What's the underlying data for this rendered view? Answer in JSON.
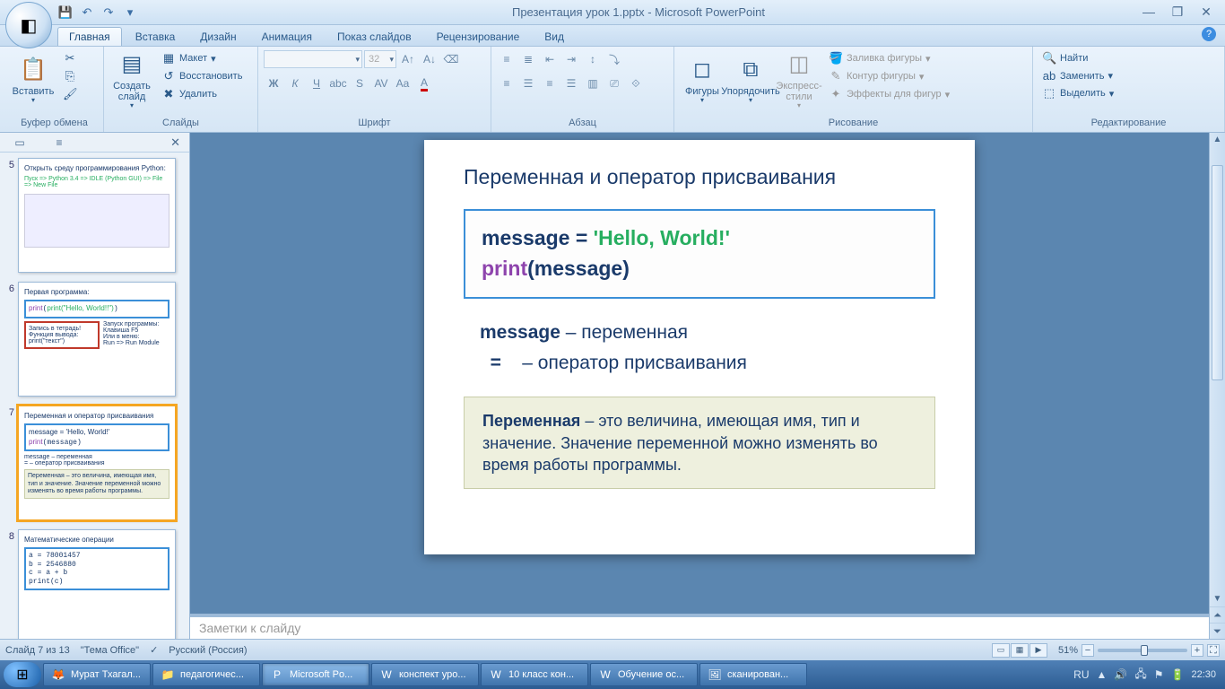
{
  "title": "Презентация урок 1.pptx - Microsoft PowerPoint",
  "tabs": {
    "home": "Главная",
    "insert": "Вставка",
    "design": "Дизайн",
    "animation": "Анимация",
    "slideshow": "Показ слайдов",
    "review": "Рецензирование",
    "view": "Вид"
  },
  "ribbon": {
    "clipboard": {
      "label": "Буфер обмена",
      "paste": "Вставить"
    },
    "slides": {
      "label": "Слайды",
      "new": "Создать\nслайд",
      "layout": "Макет",
      "reset": "Восстановить",
      "delete": "Удалить"
    },
    "font": {
      "label": "Шрифт",
      "size": "32"
    },
    "paragraph": {
      "label": "Абзац"
    },
    "drawing": {
      "label": "Рисование",
      "shapes": "Фигуры",
      "arrange": "Упорядочить",
      "styles": "Экспресс-стили",
      "fill": "Заливка фигуры",
      "outline": "Контур фигуры",
      "effects": "Эффекты для фигур"
    },
    "editing": {
      "label": "Редактирование",
      "find": "Найти",
      "replace": "Заменить",
      "select": "Выделить"
    }
  },
  "thumbs": {
    "n5": "5",
    "n6": "6",
    "n7": "7",
    "n8": "8",
    "t5_title": "Открыть среду программирования Python:",
    "t5_line": "Пуск => Python 3.4 => IDLE (Python GUI) => File => New File",
    "t6_title": "Первая программа:",
    "t6_code": "print(\"Hello, World!!\")",
    "t6_box1": "Запись в тетрадь!\nФункция вывода:\nprint(\"текст\")",
    "t6_box2": "Запуск программы:\nКлавиша F5\nИли в меню:\nRun => Run Module",
    "t7_title": "Переменная и оператор присваивания",
    "t7_c1": "message = 'Hello, World!'",
    "t7_c2": "print(message)",
    "t7_e1": "message – переменная",
    "t7_e2": "= – оператор присваивания",
    "t7_def": "Переменная – это величина, имеющая имя, тип и значение. Значение переменной можно изменять во время работы программы.",
    "t8_title": "Математические операции",
    "t8_c": "a = 78001457\nb = 2546880\nc = a + b\nprint(c)"
  },
  "slide": {
    "title": "Переменная и оператор присваивания",
    "code_msg": "message = ",
    "code_str": "'Hello, World!'",
    "code_print": "print",
    "code_print_arg": "(message)",
    "exp1_code": "message ",
    "exp1_dash": "– ",
    "exp1_rus": "переменная",
    "exp2_code": "  =    ",
    "exp2_dash": "– ",
    "exp2_rus": "оператор  присваивания",
    "def_bold": "Переменная",
    "def_rest": " – это величина, имеющая имя, тип и значение. Значение переменной можно изменять во время работы программы."
  },
  "notes_placeholder": "Заметки к слайду",
  "status": {
    "slide": "Слайд 7 из 13",
    "theme": "\"Тема Office\"",
    "lang": "Русский (Россия)",
    "zoom": "51%"
  },
  "taskbar": {
    "t1": "Мурат Тхагал...",
    "t2": "педагогичес...",
    "t3": "Microsoft Po...",
    "t4": "конспект уро...",
    "t5": "10 класс кон...",
    "t6": "Обучение ос...",
    "t7": "сканирован...",
    "lang": "RU",
    "time": "22:30"
  }
}
